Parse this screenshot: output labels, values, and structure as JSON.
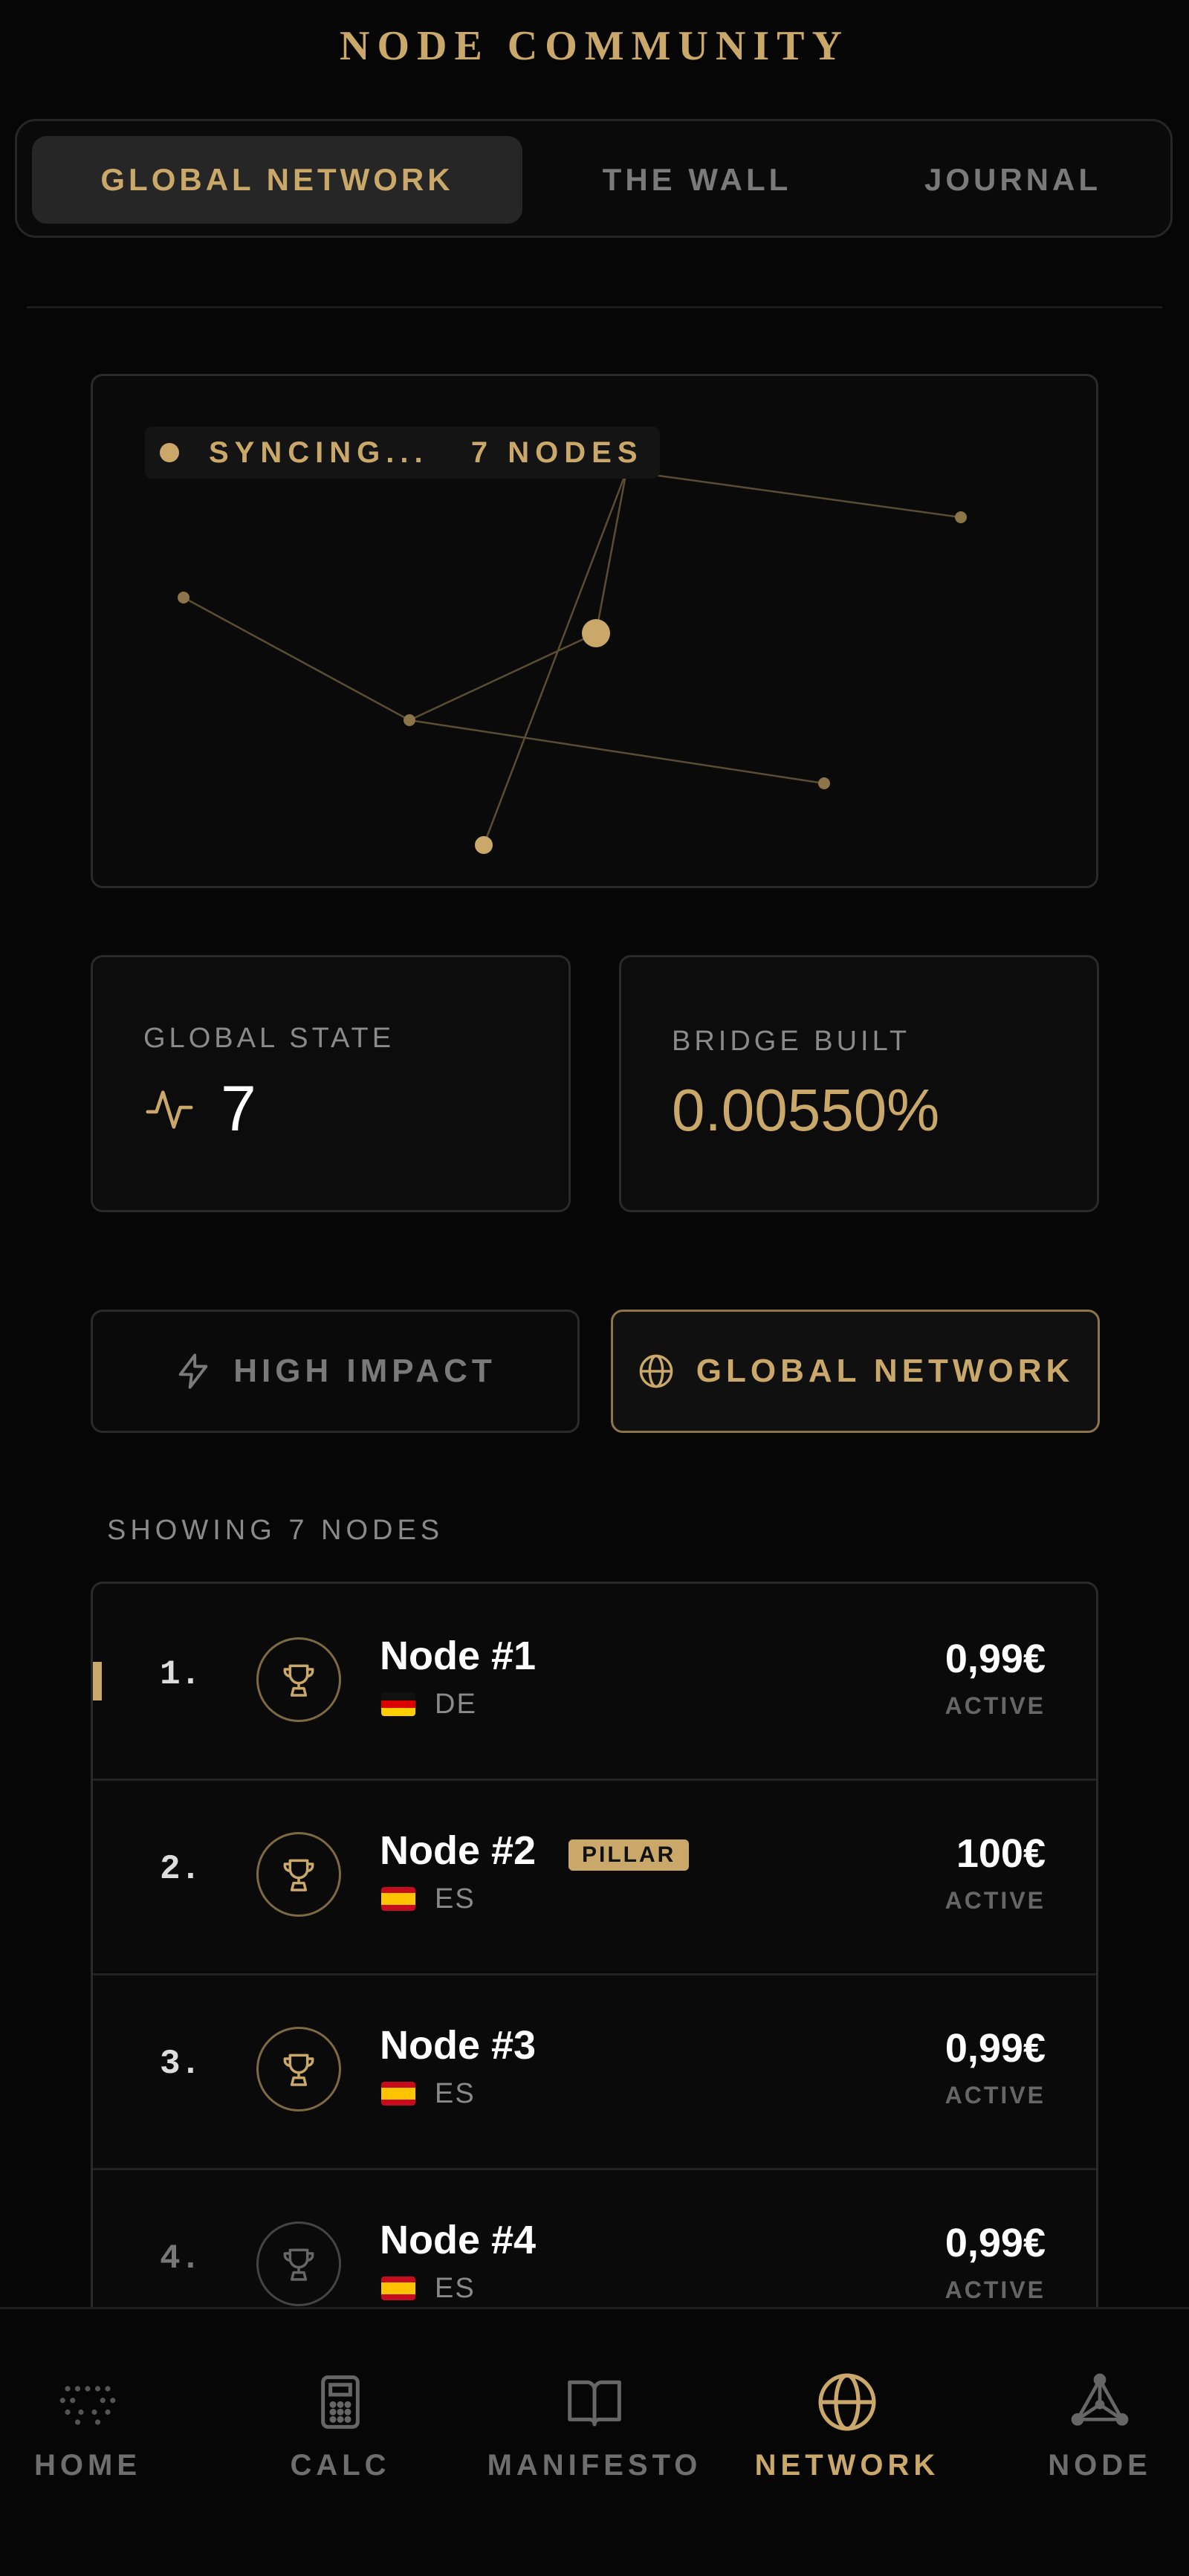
{
  "header": {
    "title": "NODE COMMUNITY"
  },
  "tabs": [
    {
      "label": "GLOBAL NETWORK",
      "active": true
    },
    {
      "label": "THE WALL",
      "active": false
    },
    {
      "label": "JOURNAL",
      "active": false
    }
  ],
  "network": {
    "status": "SYNCING...   7 NODES"
  },
  "stats": {
    "global_state": {
      "label": "GLOBAL STATE",
      "value": "7"
    },
    "bridge_built": {
      "label": "BRIDGE BUILT",
      "value": "0.00550%"
    }
  },
  "filters": {
    "high_impact": "HIGH IMPACT",
    "global_network": "GLOBAL NETWORK",
    "active": "global_network"
  },
  "list": {
    "showing": "SHOWING 7 NODES",
    "items": [
      {
        "rank": "1.",
        "name": "Node #1",
        "country": "DE",
        "flag": "flag-de",
        "amount": "0,99€",
        "status": "ACTIVE",
        "badge": ""
      },
      {
        "rank": "2.",
        "name": "Node #2",
        "country": "ES",
        "flag": "flag-es",
        "amount": "100€",
        "status": "ACTIVE",
        "badge": "PILLAR"
      },
      {
        "rank": "3.",
        "name": "Node #3",
        "country": "ES",
        "flag": "flag-es",
        "amount": "0,99€",
        "status": "ACTIVE",
        "badge": ""
      },
      {
        "rank": "4.",
        "name": "Node #4",
        "country": "ES",
        "flag": "flag-es",
        "amount": "0,99€",
        "status": "ACTIVE",
        "badge": ""
      }
    ]
  },
  "nav": [
    {
      "label": "HOME",
      "icon": "dots-icon",
      "active": false
    },
    {
      "label": "CALC",
      "icon": "calculator-icon",
      "active": false
    },
    {
      "label": "MANIFESTO",
      "icon": "book-icon",
      "active": false
    },
    {
      "label": "NETWORK",
      "icon": "globe-icon",
      "active": true
    },
    {
      "label": "NODE",
      "icon": "triangle-network-icon",
      "active": false
    }
  ],
  "colors": {
    "accent": "#c9a86a",
    "background": "#060606",
    "card": "#0c0c0c",
    "border": "#2a2a2a"
  }
}
